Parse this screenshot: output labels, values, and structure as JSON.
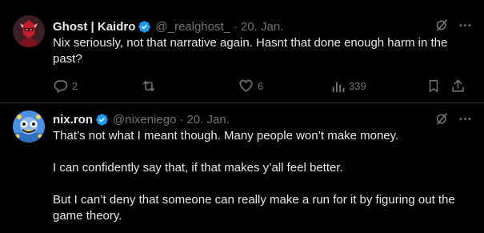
{
  "tweets": [
    {
      "author_name": "Ghost | Kaidro",
      "handle": "@_realghost_",
      "separator": "·",
      "date": "20. Jan.",
      "text": "Nix seriously, not that narrative again. Hasnt that done enough harm in the past?",
      "stats": {
        "replies": "2",
        "likes": "6",
        "views": "339"
      }
    },
    {
      "author_name": "nix.ron",
      "handle": "@nixeniego",
      "separator": "·",
      "date": "20. Jan.",
      "paragraphs": [
        "That’s not what I meant though. Many people won’t make money.",
        "I can confidently say that, if that makes y’all feel better.",
        "But I can’t deny that someone can really make a run for it by figuring out the game theory."
      ]
    }
  ],
  "icons": {
    "verified": "verified-badge-icon",
    "grok": "grok-icon",
    "more": "more-icon",
    "reply": "reply-icon",
    "retweet": "retweet-icon",
    "like": "like-icon",
    "views": "views-icon",
    "bookmark": "bookmark-icon",
    "share": "share-icon"
  },
  "colors": {
    "background": "#000000",
    "text": "#e7e9ea",
    "muted": "#71767b",
    "verified": "#1d9bf0",
    "divider": "#2f3336"
  }
}
